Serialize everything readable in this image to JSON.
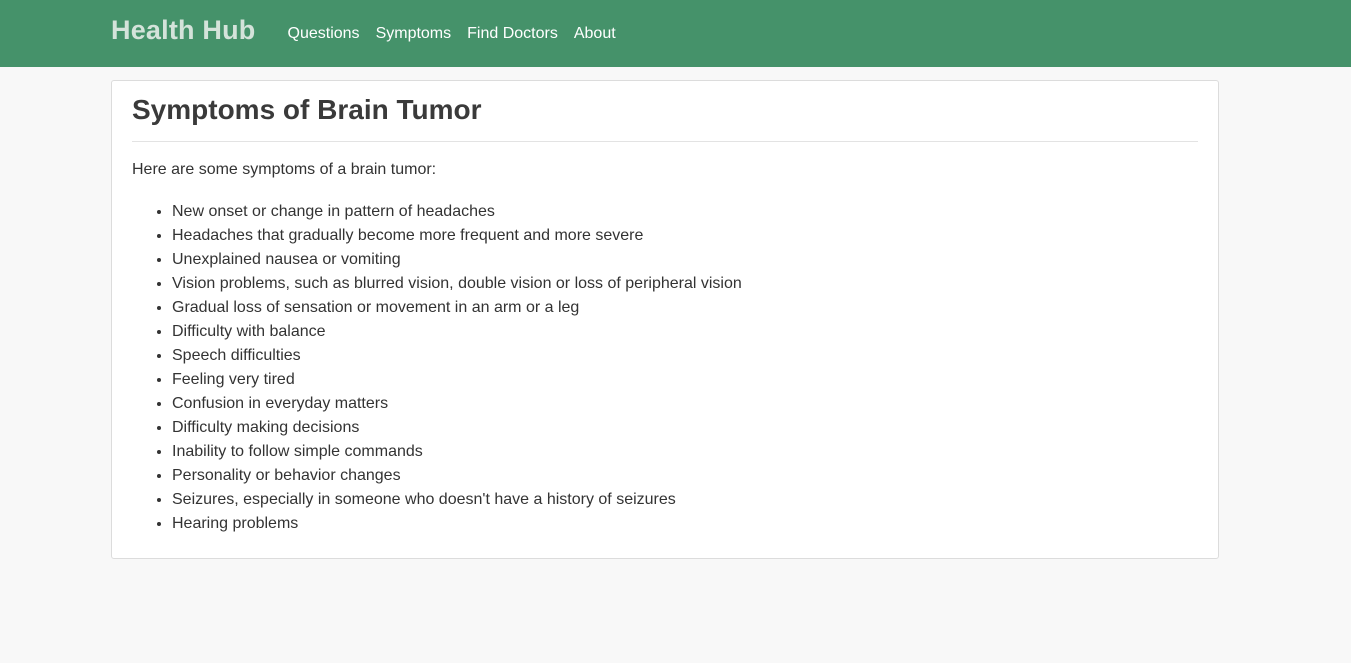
{
  "navbar": {
    "brand": "Health Hub",
    "links": [
      "Questions",
      "Symptoms",
      "Find Doctors",
      "About"
    ]
  },
  "main": {
    "title": "Symptoms of Brain Tumor",
    "intro": "Here are some symptoms of a brain tumor:",
    "symptoms": [
      "New onset or change in pattern of headaches",
      "Headaches that gradually become more frequent and more severe",
      "Unexplained nausea or vomiting",
      "Vision problems, such as blurred vision, double vision or loss of peripheral vision",
      "Gradual loss of sensation or movement in an arm or a leg",
      "Difficulty with balance",
      "Speech difficulties",
      "Feeling very tired",
      "Confusion in everyday matters",
      "Difficulty making decisions",
      "Inability to follow simple commands",
      "Personality or behavior changes",
      "Seizures, especially in someone who doesn't have a history of seizures",
      "Hearing problems"
    ]
  },
  "colors": {
    "navbar_bg": "#45926a",
    "brand_text": "#d4e3da",
    "page_bg": "#f8f8f8",
    "card_bg": "#ffffff"
  }
}
